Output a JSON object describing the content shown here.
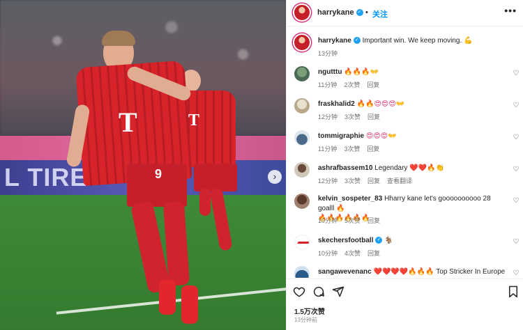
{
  "header": {
    "username": "harrykane",
    "separator": "•",
    "follow_label": "关注",
    "more_label": "•••"
  },
  "caption": {
    "username": "harrykane",
    "text": "Important win. We keep moving.",
    "emoji": "💪",
    "time": "13分钟"
  },
  "comments": [
    {
      "user": "ngutttu",
      "text": "",
      "emoji": "🔥🔥🔥👐",
      "time": "11分钟",
      "likes": "2次赞",
      "reply": "回复",
      "extra": ""
    },
    {
      "user": "fraskhalid2",
      "text": "",
      "emoji": "🔥🔥😍😍😍👐",
      "time": "12分钟",
      "likes": "3次赞",
      "reply": "回复",
      "extra": ""
    },
    {
      "user": "tommigraphie",
      "text": "",
      "emoji": "😍😍😍👐",
      "time": "11分钟",
      "likes": "3次赞",
      "reply": "回复",
      "extra": ""
    },
    {
      "user": "ashrafbassem10",
      "text": "Legendary",
      "emoji": "❤️❤️🔥👏",
      "time": "12分钟",
      "likes": "3次赞",
      "reply": "回复",
      "extra": "查看翻译"
    },
    {
      "user": "kelvin_sospeter_83",
      "text": "Hharry kane let's goooooooooo 28 goalll",
      "emoji": "🔥",
      "emoji2": "🔥🔥🔥🔥🔥🔥",
      "time": "10分钟",
      "likes": "5次赞",
      "reply": "回复",
      "extra": ""
    },
    {
      "user": "skechersfootball",
      "text": "",
      "emoji": "🐐",
      "time": "10分钟",
      "likes": "4次赞",
      "reply": "回复",
      "extra": ""
    },
    {
      "user": "sangawevenanc",
      "text": "Top Stricker In Europe",
      "emoji": "❤️❤️❤️❤️🔥🔥🔥",
      "time": "",
      "likes": "",
      "reply": "",
      "extra": ""
    }
  ],
  "actions": {
    "likes_count": "1.5万次赞",
    "post_time": "13分钟前"
  },
  "photo": {
    "ad_text": "L TIRE",
    "jersey_number": "9"
  },
  "icons": {
    "more": "more-options-icon",
    "heart": "heart-icon",
    "comment": "comment-icon",
    "share": "share-icon",
    "bookmark": "bookmark-icon",
    "verified": "verified-badge-icon",
    "next": "chevron-right-icon"
  },
  "colors": {
    "follow": "#0095f6",
    "verified": "#1da1f2",
    "jersey_red": "#d8232a"
  }
}
